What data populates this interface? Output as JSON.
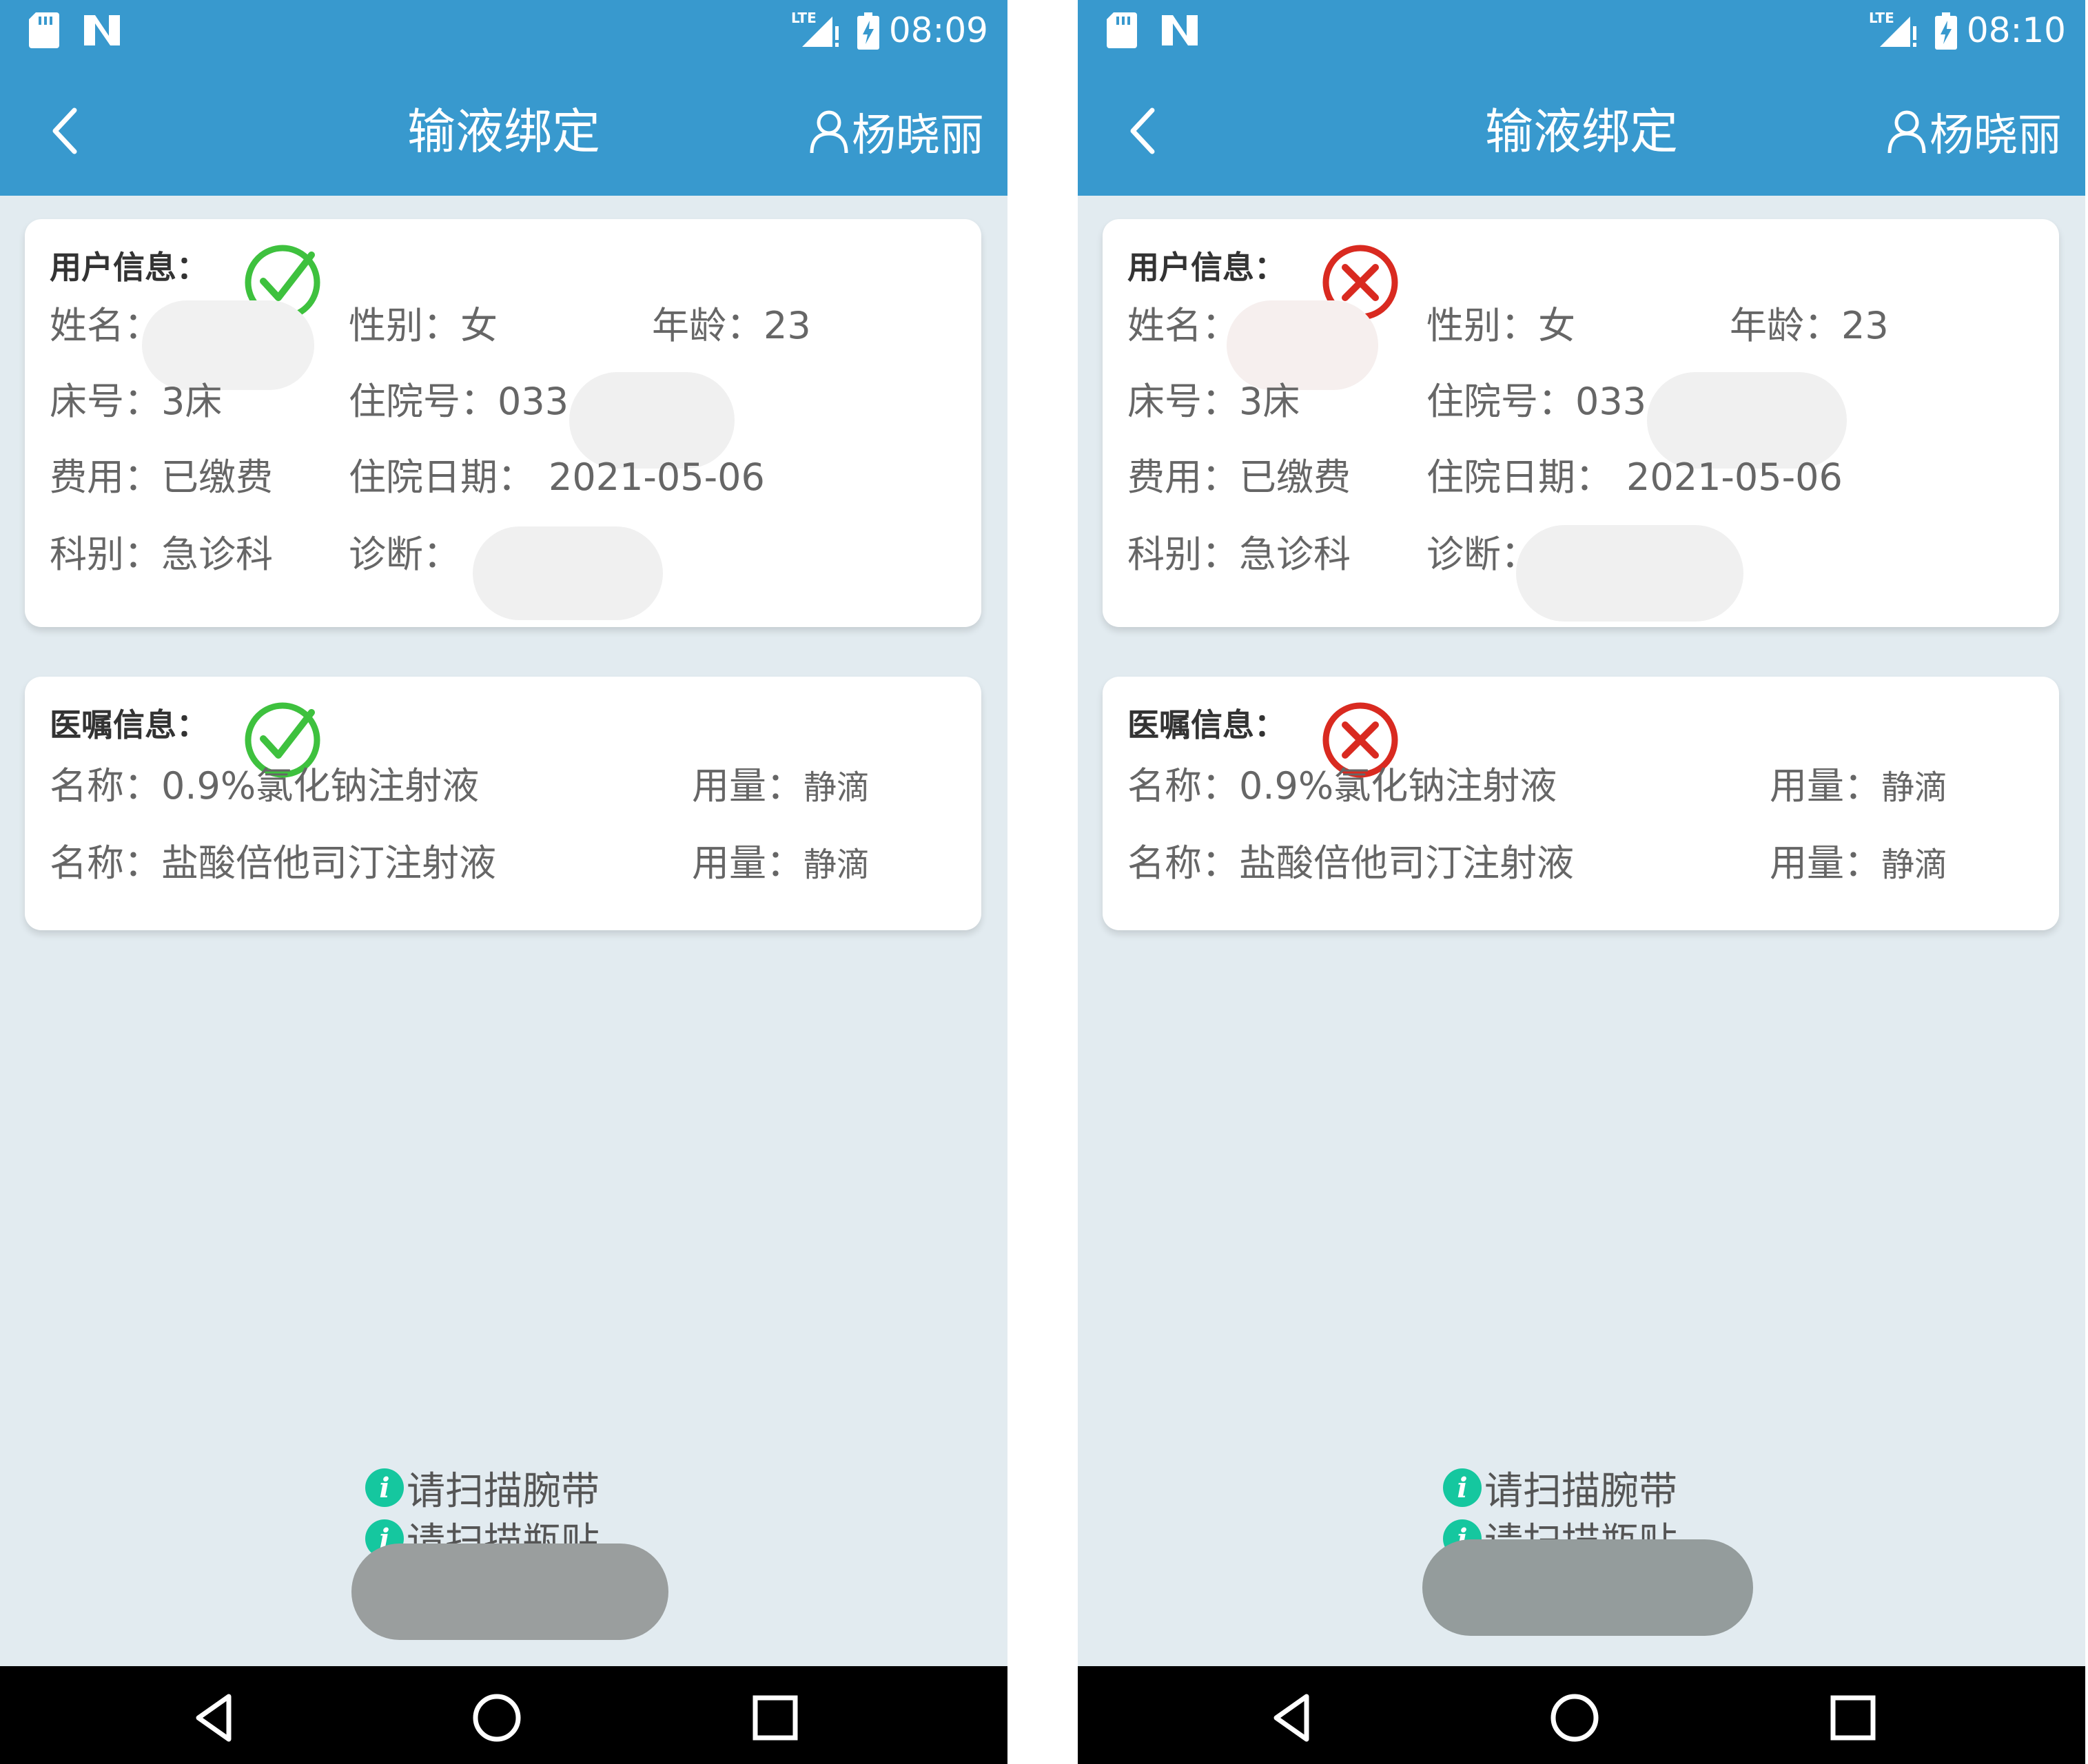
{
  "screens": [
    {
      "status_bar": {
        "time": "08:09",
        "signal_label": "LTE"
      },
      "app_bar": {
        "title": "输液绑定",
        "user_name": "杨晓丽"
      },
      "patient_card": {
        "title": "用户信息：",
        "match_status": "success",
        "name_label": "姓名：",
        "gender_label": "性别：",
        "gender_value": "女",
        "age_label": "年龄：",
        "age_value": "23",
        "bed_label": "床号：",
        "bed_value": "3床",
        "admission_no_label": "住院号：",
        "admission_no_value": "033",
        "fee_label": "费用：",
        "fee_value": "已缴费",
        "admission_date_label": "住院日期：",
        "admission_date_value": "2021-05-06",
        "department_label": "科别：",
        "department_value": "急诊科",
        "diagnosis_label": "诊断："
      },
      "order_card": {
        "title": "医嘱信息：",
        "match_status": "success",
        "items": [
          {
            "name_label": "名称：",
            "name_value": "0.9%氯化钠注射液",
            "usage_label": "用量：",
            "usage_value": "静滴"
          },
          {
            "name_label": "名称：",
            "name_value": "盐酸倍他司汀注射液",
            "usage_label": "用量：",
            "usage_value": "静滴"
          }
        ]
      },
      "prompts": [
        "请扫描腕带",
        "请扫描瓶贴"
      ]
    },
    {
      "status_bar": {
        "time": "08:10",
        "signal_label": "LTE"
      },
      "app_bar": {
        "title": "输液绑定",
        "user_name": "杨晓丽"
      },
      "patient_card": {
        "title": "用户信息：",
        "match_status": "fail",
        "name_label": "姓名：",
        "gender_label": "性别：",
        "gender_value": "女",
        "age_label": "年龄：",
        "age_value": "23",
        "bed_label": "床号：",
        "bed_value": "3床",
        "admission_no_label": "住院号：",
        "admission_no_value": "033",
        "fee_label": "费用：",
        "fee_value": "已缴费",
        "admission_date_label": "住院日期：",
        "admission_date_value": "2021-05-06",
        "department_label": "科别：",
        "department_value": "急诊科",
        "diagnosis_label": "诊断："
      },
      "order_card": {
        "title": "医嘱信息：",
        "match_status": "fail",
        "items": [
          {
            "name_label": "名称：",
            "name_value": "0.9%氯化钠注射液",
            "usage_label": "用量：",
            "usage_value": "静滴"
          },
          {
            "name_label": "名称：",
            "name_value": "盐酸倍他司汀注射液",
            "usage_label": "用量：",
            "usage_value": "静滴"
          }
        ]
      },
      "prompts": [
        "请扫描腕带",
        "请扫描瓶贴"
      ]
    }
  ],
  "icons": {
    "status_success": "check-circle-icon",
    "status_fail": "x-circle-icon",
    "back": "back-arrow-icon",
    "user": "user-icon",
    "info": "info-icon"
  },
  "colors": {
    "header": "#3899ce",
    "background": "#e2ebf0",
    "success": "#3ec13e",
    "fail": "#d92a20",
    "info": "#15c79f"
  }
}
